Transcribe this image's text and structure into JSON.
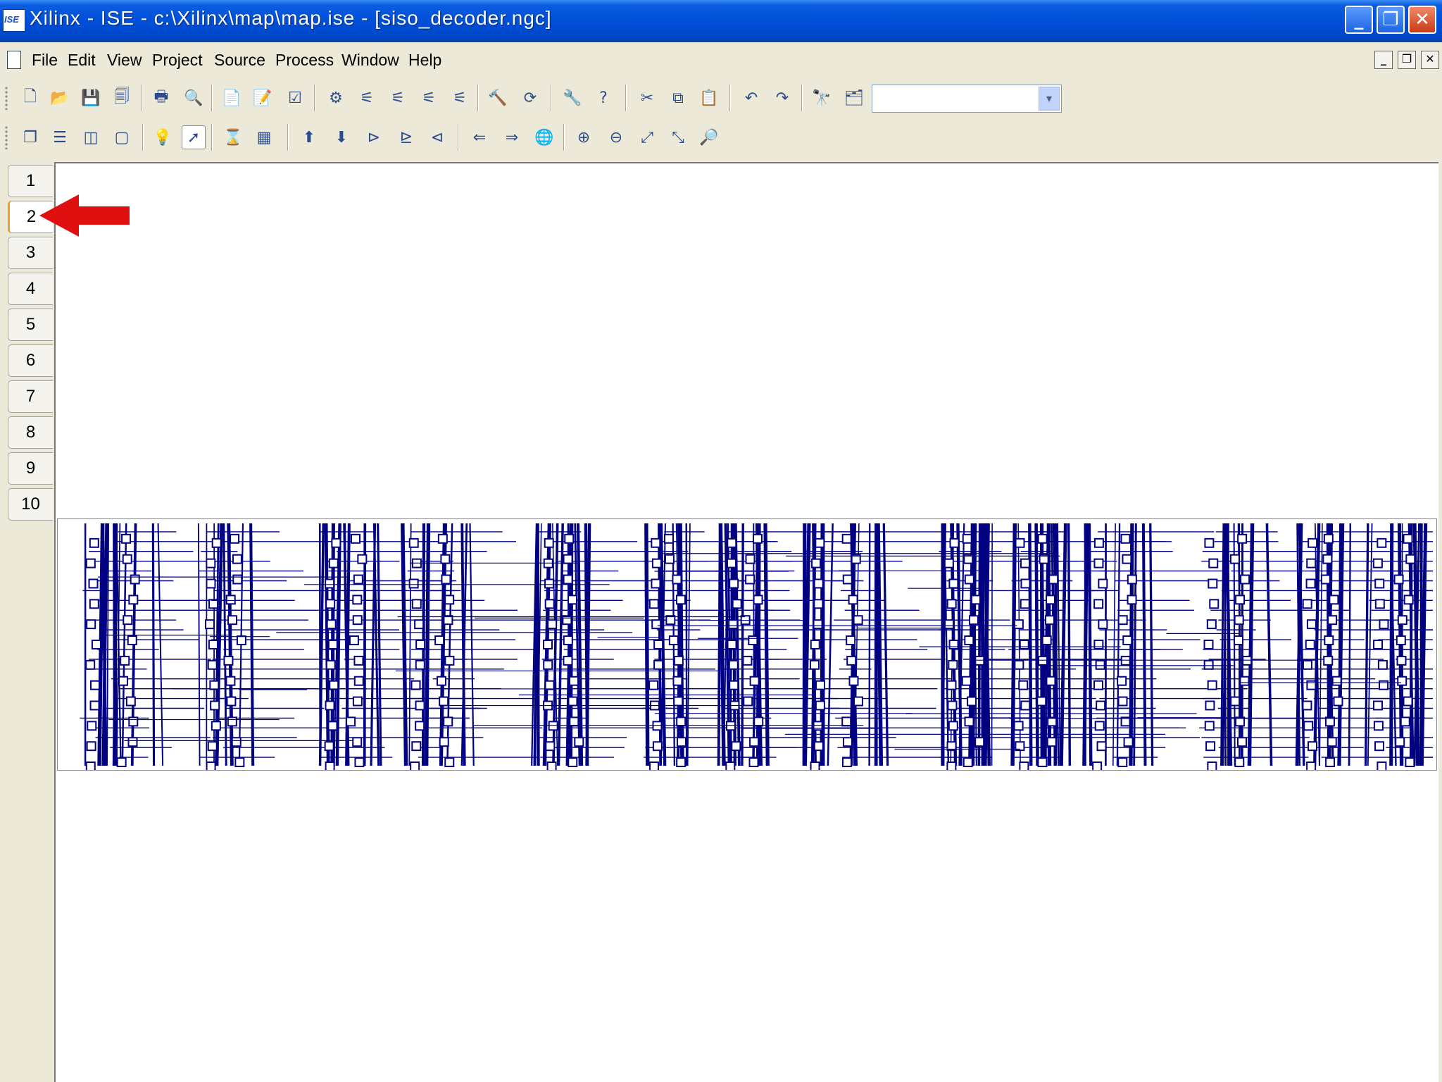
{
  "window": {
    "app_icon_label": "ISE",
    "title": "Xilinx - ISE - c:\\Xilinx\\map\\map.ise - [siso_decoder.ngc]",
    "minimize_glyph": "_",
    "restore_glyph": "❐",
    "close_glyph": "✕"
  },
  "menu": {
    "items": [
      "File",
      "Edit",
      "View",
      "Project",
      "Source",
      "Process",
      "Window",
      "Help"
    ],
    "mdi": {
      "minimize": "_",
      "restore": "❐",
      "close": "✕"
    }
  },
  "toolbar1": {
    "buttons": [
      {
        "icon": "new-file-icon",
        "glyph": "🗋"
      },
      {
        "icon": "open-folder-icon",
        "glyph": "📂"
      },
      {
        "icon": "save-icon",
        "glyph": "💾"
      },
      {
        "icon": "save-all-icon",
        "glyph": "🗐"
      },
      {
        "icon": "print-icon",
        "glyph": "🖶"
      },
      {
        "icon": "print-preview-icon",
        "glyph": "🔍"
      },
      {
        "icon": "properties-icon",
        "glyph": "📄"
      },
      {
        "icon": "edit-icon",
        "glyph": "📝"
      },
      {
        "icon": "check-icon",
        "glyph": "☑"
      },
      {
        "icon": "settings-icon",
        "glyph": "⚙"
      },
      {
        "icon": "cut-net-icon",
        "glyph": "⚟"
      },
      {
        "icon": "cut-net-2-icon",
        "glyph": "⚟"
      },
      {
        "icon": "cut-net-3-icon",
        "glyph": "⚟"
      },
      {
        "icon": "cut-net-4-icon",
        "glyph": "⚟"
      },
      {
        "icon": "hammer-icon",
        "glyph": "🔨"
      },
      {
        "icon": "refresh-icon",
        "glyph": "⟳"
      },
      {
        "icon": "wrench-icon",
        "glyph": "🔧"
      },
      {
        "icon": "context-help-icon",
        "glyph": "?"
      },
      {
        "icon": "scissors-icon",
        "glyph": "✂"
      },
      {
        "icon": "copy-icon",
        "glyph": "⧉"
      },
      {
        "icon": "paste-icon",
        "glyph": "📋"
      },
      {
        "icon": "undo-icon",
        "glyph": "↶"
      },
      {
        "icon": "redo-icon",
        "glyph": "↷"
      },
      {
        "icon": "binoculars-icon",
        "glyph": "🔭"
      },
      {
        "icon": "find-in-files-icon",
        "glyph": "🗂"
      }
    ],
    "search_value": ""
  },
  "toolbar2": {
    "buttons": [
      {
        "icon": "cascade-windows-icon",
        "glyph": "❐"
      },
      {
        "icon": "tile-horizontal-icon",
        "glyph": "☰"
      },
      {
        "icon": "tile-vertical-icon",
        "glyph": "◫"
      },
      {
        "icon": "window-icon",
        "glyph": "▢"
      },
      {
        "icon": "lightbulb-icon",
        "glyph": "💡"
      },
      {
        "icon": "select-pointer-icon",
        "glyph": "➚"
      },
      {
        "icon": "hourglass-icon",
        "glyph": "⌛"
      },
      {
        "icon": "ref-icon",
        "glyph": "▦"
      },
      {
        "icon": "push-up-icon",
        "glyph": "⬆"
      },
      {
        "icon": "push-down-icon",
        "glyph": "⬇"
      },
      {
        "icon": "symbol-icon",
        "glyph": "⊳"
      },
      {
        "icon": "symbol-2-icon",
        "glyph": "⊵"
      },
      {
        "icon": "symbol-3-icon",
        "glyph": "⊲"
      },
      {
        "icon": "back-icon",
        "glyph": "⇐"
      },
      {
        "icon": "forward-icon",
        "glyph": "⇒"
      },
      {
        "icon": "globe-icon",
        "glyph": "🌐"
      },
      {
        "icon": "zoom-in-icon",
        "glyph": "⊕"
      },
      {
        "icon": "zoom-out-icon",
        "glyph": "⊖"
      },
      {
        "icon": "zoom-fit-icon",
        "glyph": "⤢"
      },
      {
        "icon": "zoom-full-icon",
        "glyph": "⤡"
      },
      {
        "icon": "zoom-select-icon",
        "glyph": "🔎"
      }
    ]
  },
  "sheets": {
    "tabs": [
      "1",
      "2",
      "3",
      "4",
      "5",
      "6",
      "7",
      "8",
      "9",
      "10"
    ],
    "active": "2",
    "active_index": 1
  },
  "annotation": {
    "arrow_color": "#e01010"
  },
  "colors": {
    "wire": "#000080",
    "titlebar": "#0050d8",
    "chrome": "#ece9d8"
  }
}
